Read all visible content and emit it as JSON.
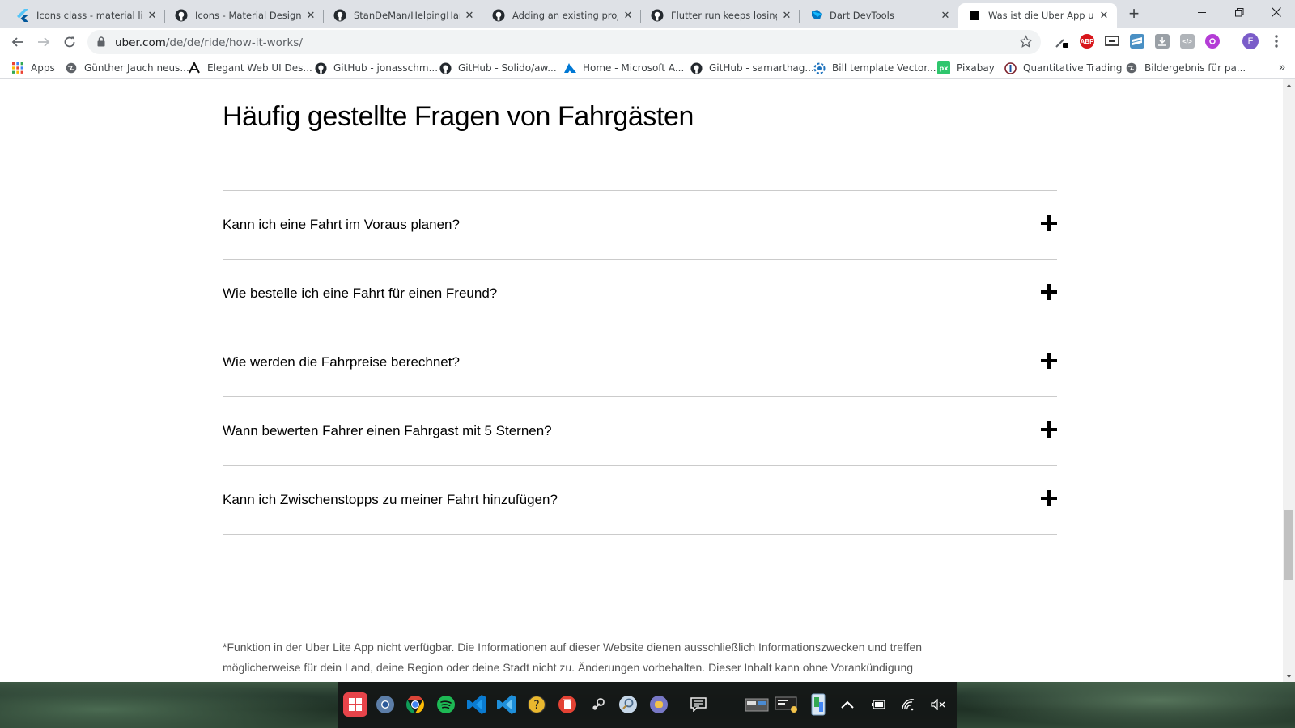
{
  "browser": {
    "tabs": [
      {
        "title": "Icons class - material library",
        "favicon": "flutter-icon",
        "active": false
      },
      {
        "title": "Icons - Material Design",
        "favicon": "github-icon",
        "active": false
      },
      {
        "title": "StanDeMan/HelpingHand",
        "favicon": "github-icon",
        "active": false
      },
      {
        "title": "Adding an existing project",
        "favicon": "github-icon",
        "active": false
      },
      {
        "title": "Flutter run keeps losing connection",
        "favicon": "github-icon",
        "active": false
      },
      {
        "title": "Dart DevTools",
        "favicon": "dart-icon",
        "active": false
      },
      {
        "title": "Was ist die Uber App und wie",
        "favicon": "uber-icon",
        "active": true
      }
    ],
    "address": {
      "host": "uber.com",
      "path": "/de/de/ride/how-it-works/"
    },
    "profile_initial": "F",
    "bookmarks": [
      {
        "label": "Apps",
        "icon": "apps-grid-icon"
      },
      {
        "label": "Günther Jauch neus...",
        "icon": "globe-icon"
      },
      {
        "label": "Elegant Web UI Des...",
        "icon": "a-logo-icon"
      },
      {
        "label": "GitHub - jonasschm...",
        "icon": "github-icon"
      },
      {
        "label": "GitHub - Solido/aw...",
        "icon": "github-icon"
      },
      {
        "label": "Home - Microsoft A...",
        "icon": "azure-icon"
      },
      {
        "label": "GitHub - samarthag...",
        "icon": "github-icon"
      },
      {
        "label": "Bill template Vector...",
        "icon": "vector-icon"
      },
      {
        "label": "Pixabay",
        "icon": "pixabay-icon"
      },
      {
        "label": "Quantitative Trading",
        "icon": "quant-icon"
      },
      {
        "label": "Bildergebnis für pa...",
        "icon": "globe-icon"
      }
    ]
  },
  "page": {
    "faq_title": "Häufig gestellte Fragen von Fahrgästen",
    "faq_items": [
      "Kann ich eine Fahrt im Voraus planen?",
      "Wie bestelle ich eine Fahrt für einen Freund?",
      "Wie werden die Fahrpreise berechnet?",
      "Wann bewerten Fahrer einen Fahrgast mit 5 Sternen?",
      "Kann ich Zwischenstopps zu meiner Fahrt hinzufügen?"
    ],
    "disclaimer_line1": "*Funktion in der Uber Lite App nicht verfügbar. Die Informationen auf dieser Website dienen ausschließlich Informationszwecken und treffen",
    "disclaimer_line2": "möglicherweise für dein Land, deine Region oder deine Stadt nicht zu. Änderungen vorbehalten. Dieser Inhalt kann ohne Vorankündigung"
  },
  "taskbar": {
    "apps": [
      "windows-start-icon",
      "chromium-icon",
      "chrome-icon",
      "spotify-icon",
      "vscode-icon",
      "vscode-insiders-icon",
      "help-icon",
      "delete-app-icon",
      "steam-icon",
      "magnifier-app-icon",
      "discord-icon",
      "notes-icon"
    ],
    "tray": [
      "window-switch-icon",
      "monitor-icon",
      "phone-link-icon",
      "chevron-up-icon",
      "battery-icon",
      "wifi-icon",
      "volume-muted-icon"
    ]
  },
  "colors": {
    "tabstrip": "#dee1e6",
    "faq_divider": "#cbcbcb",
    "disclaimer_text": "#545454",
    "abp_red": "#d8161b",
    "profile_purple": "#7a5cc9"
  }
}
